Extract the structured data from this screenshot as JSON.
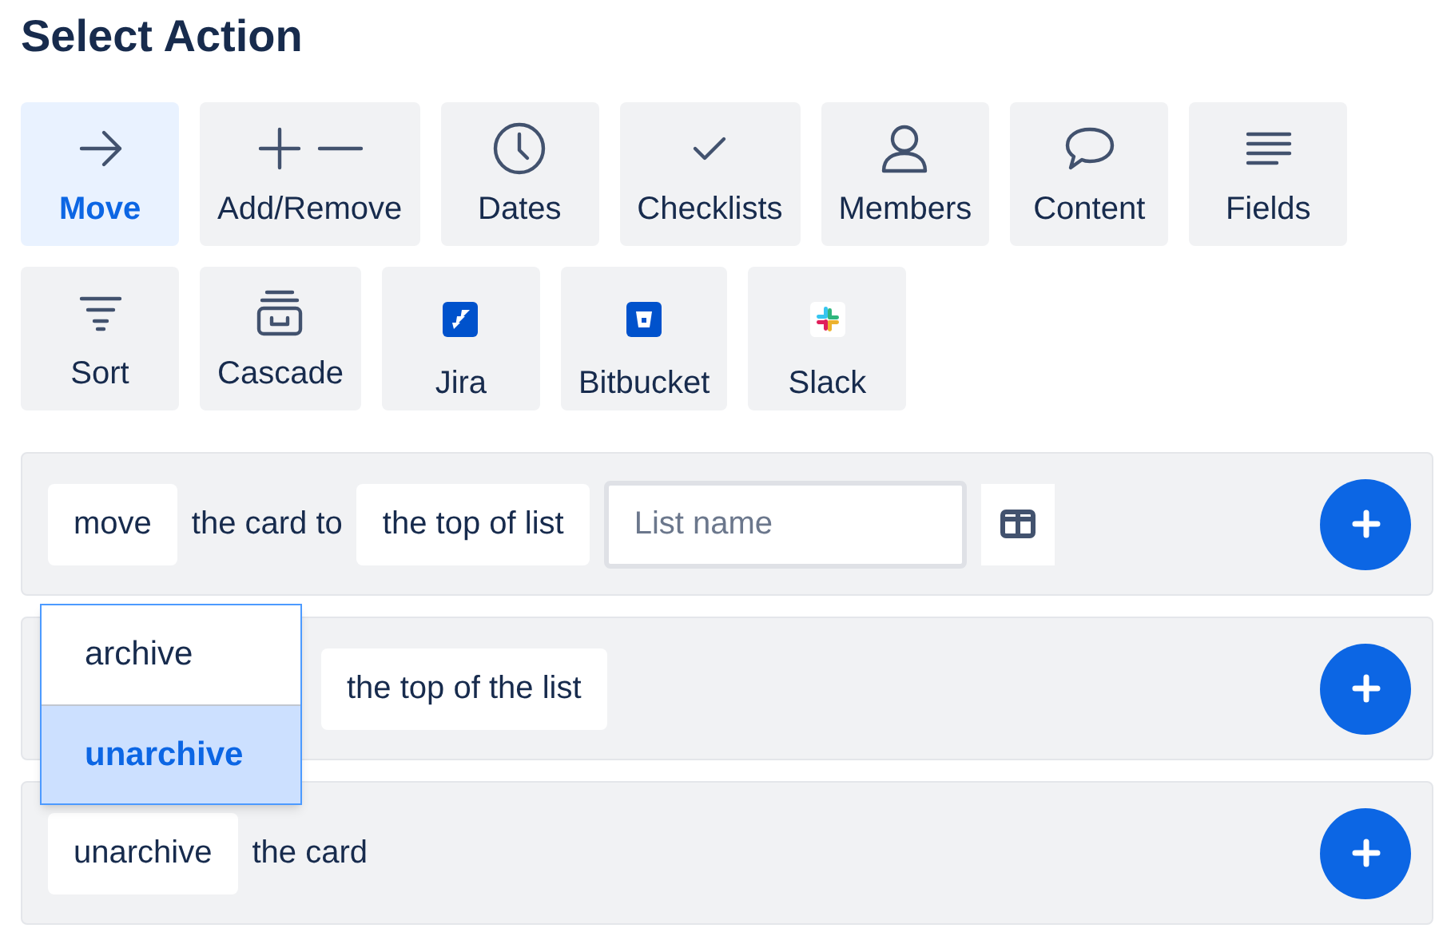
{
  "title": "Select Action",
  "actions": [
    {
      "label": "Move",
      "selected": true
    },
    {
      "label": "Add/Remove",
      "selected": false
    },
    {
      "label": "Dates",
      "selected": false
    },
    {
      "label": "Checklists",
      "selected": false
    },
    {
      "label": "Members",
      "selected": false
    },
    {
      "label": "Content",
      "selected": false
    },
    {
      "label": "Fields",
      "selected": false
    },
    {
      "label": "Sort",
      "selected": false
    },
    {
      "label": "Cascade",
      "selected": false
    },
    {
      "label": "Jira",
      "selected": false
    },
    {
      "label": "Bitbucket",
      "selected": false
    },
    {
      "label": "Slack",
      "selected": false
    }
  ],
  "rules": [
    {
      "parts": [
        {
          "kind": "token",
          "text": "move"
        },
        {
          "kind": "text",
          "text": "the card to"
        },
        {
          "kind": "token",
          "text": "the top of list"
        },
        {
          "kind": "input",
          "placeholder": "List name"
        },
        {
          "kind": "icon_button"
        }
      ]
    },
    {
      "parts": [
        {
          "kind": "hidden"
        },
        {
          "kind": "token",
          "text": "the top of the list"
        }
      ]
    },
    {
      "parts": [
        {
          "kind": "token",
          "text": "unarchive"
        },
        {
          "kind": "text",
          "text": "the card"
        }
      ]
    }
  ],
  "dropdown": {
    "options": [
      {
        "label": "archive",
        "selected": false
      },
      {
        "label": "unarchive",
        "selected": true
      }
    ]
  }
}
